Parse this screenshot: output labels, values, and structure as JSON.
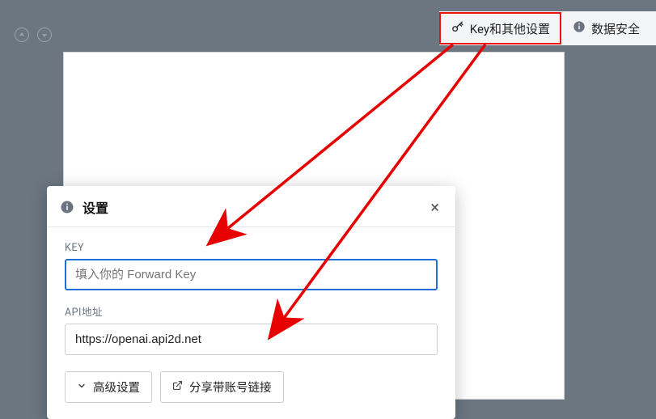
{
  "toolbar": {
    "key_settings_label": "Key和其他设置",
    "data_security_label": "数据安全"
  },
  "modal": {
    "title": "设置",
    "key_label": "KEY",
    "key_placeholder": "填入你的 Forward Key",
    "api_label": "API地址",
    "api_value": "https://openai.api2d.net",
    "advanced_btn": "高级设置",
    "share_btn": "分享带账号链接"
  }
}
